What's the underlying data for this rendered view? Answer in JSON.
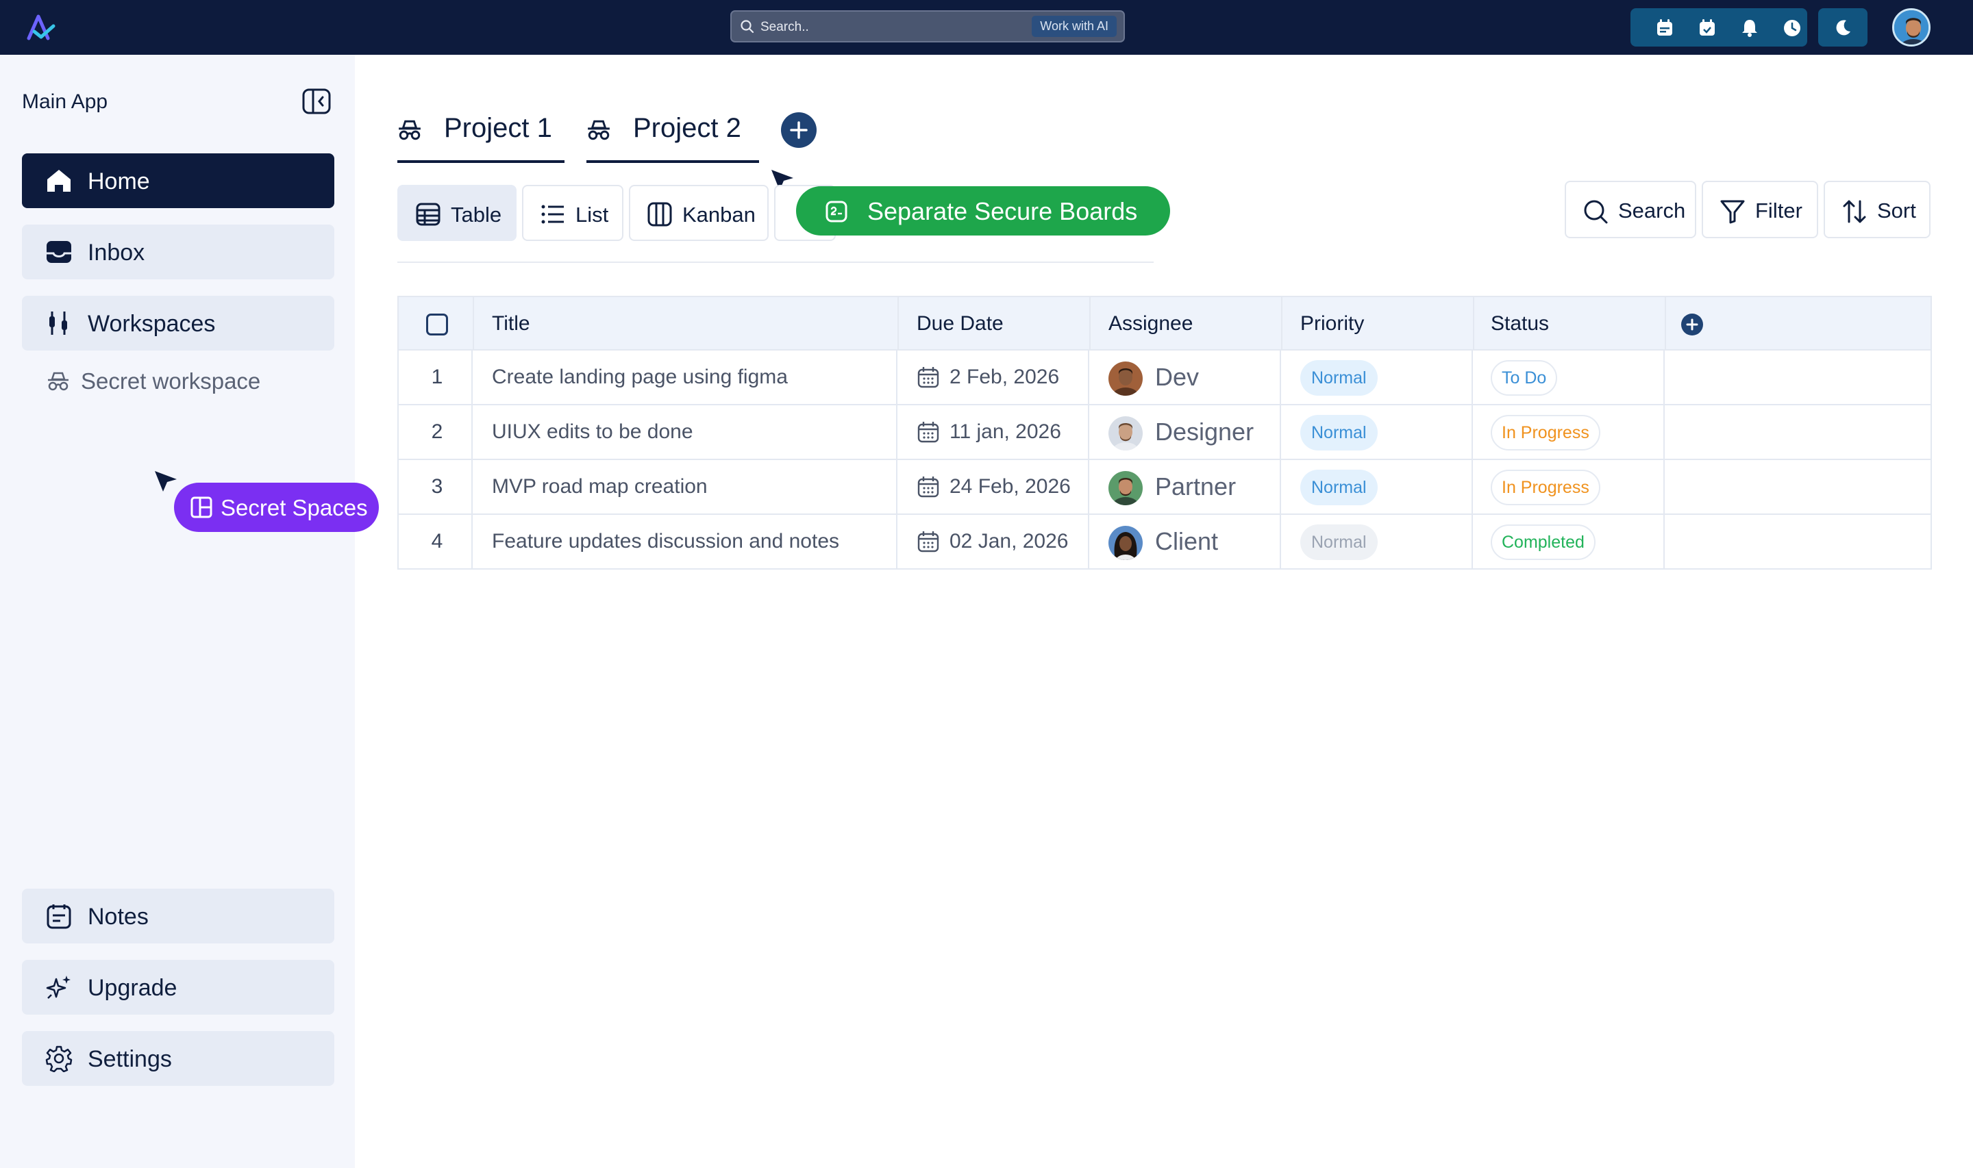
{
  "topbar": {
    "search_placeholder": "Search..",
    "ai_button": "Work with AI",
    "icons": [
      "calendar-icon",
      "calendar-check-icon",
      "bell-icon",
      "clock-icon"
    ],
    "theme_icon": "moon-icon"
  },
  "sidebar": {
    "title": "Main App",
    "nav": [
      {
        "label": "Home",
        "icon": "home-icon",
        "active": true
      },
      {
        "label": "Inbox",
        "icon": "inbox-icon"
      },
      {
        "label": "Workspaces",
        "icon": "sliders-icon"
      }
    ],
    "secret_workspace": "Secret  workspace",
    "secret_pill": "Secret Spaces",
    "bottom_nav": [
      {
        "label": "Notes",
        "icon": "notes-icon"
      },
      {
        "label": "Upgrade",
        "icon": "sparkles-icon"
      },
      {
        "label": "Settings",
        "icon": "gear-icon"
      }
    ]
  },
  "projects": {
    "tabs": [
      "Project 1",
      "Project 2"
    ]
  },
  "views": {
    "table": "Table",
    "list": "List",
    "kanban": "Kanban",
    "feature_pill": "Separate Secure Boards"
  },
  "tools": {
    "search": "Search",
    "filter": "Filter",
    "sort": "Sort"
  },
  "table": {
    "columns": [
      "Title",
      "Due Date",
      "Assignee",
      "Priority",
      "Status"
    ],
    "rows": [
      {
        "num": "1",
        "title": "Create landing page using figma",
        "due": "2 Feb, 2026",
        "assignee": "Dev",
        "priority": "Normal",
        "status": "To Do"
      },
      {
        "num": "2",
        "title": "UIUX edits to be done",
        "due": "11 jan, 2026",
        "assignee": "Designer",
        "priority": "Normal",
        "status": "In Progress"
      },
      {
        "num": "3",
        "title": "MVP road map creation",
        "due": "24 Feb, 2026",
        "assignee": "Partner",
        "priority": "Normal",
        "status": "In Progress"
      },
      {
        "num": "4",
        "title": "Feature updates discussion and notes",
        "due": "02 Jan, 2026",
        "assignee": "Client",
        "priority": "Normal",
        "status": "Completed"
      }
    ]
  },
  "colors": {
    "navy": "#0d1b3d",
    "purple": "#7b2ff2",
    "green": "#1ea64b",
    "todo": "#3a8fd6",
    "in_progress": "#f0921e",
    "completed": "#22b35a"
  }
}
